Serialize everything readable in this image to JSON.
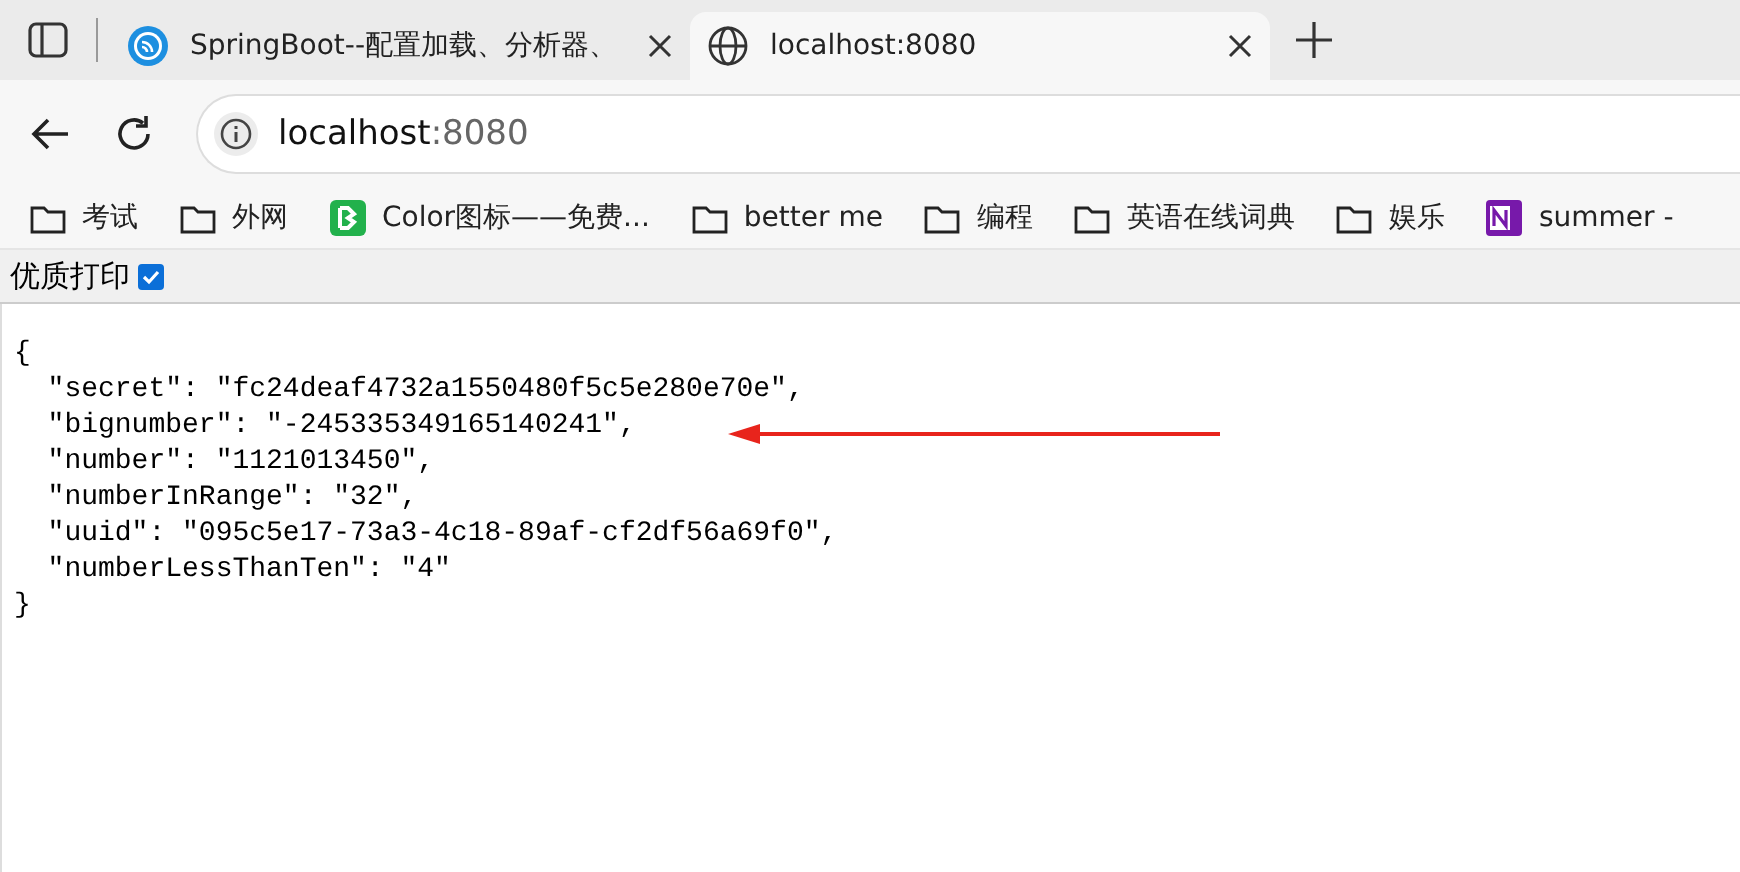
{
  "tabs": [
    {
      "title": "SpringBoot--配置加载、分析器、",
      "selected": false,
      "kind": "feed"
    },
    {
      "title": "localhost:8080",
      "selected": true,
      "kind": "globe"
    }
  ],
  "address": {
    "host": "localhost",
    "port": ":8080"
  },
  "bookmarks": [
    {
      "label": "考试",
      "kind": "folder"
    },
    {
      "label": "外网",
      "kind": "folder"
    },
    {
      "label": "Color图标——免费...",
      "kind": "app"
    },
    {
      "label": "better me",
      "kind": "folder"
    },
    {
      "label": "编程",
      "kind": "folder"
    },
    {
      "label": "英语在线词典",
      "kind": "folder"
    },
    {
      "label": "娱乐",
      "kind": "folder"
    },
    {
      "label": "summer -",
      "kind": "note"
    }
  ],
  "print_option": {
    "label": "优质打印",
    "checked": true
  },
  "json_lines": [
    "{",
    "  \"secret\": \"fc24deaf4732a1550480f5c5e280e70e\",",
    "  \"bignumber\": \"-245335349165140241\",",
    "  \"number\": \"1121013450\",",
    "  \"numberInRange\": \"32\",",
    "  \"uuid\": \"095c5e17-73a3-4c18-89af-cf2df56a69f0\",",
    "  \"numberLessThanTen\": \"4\"",
    "}"
  ]
}
